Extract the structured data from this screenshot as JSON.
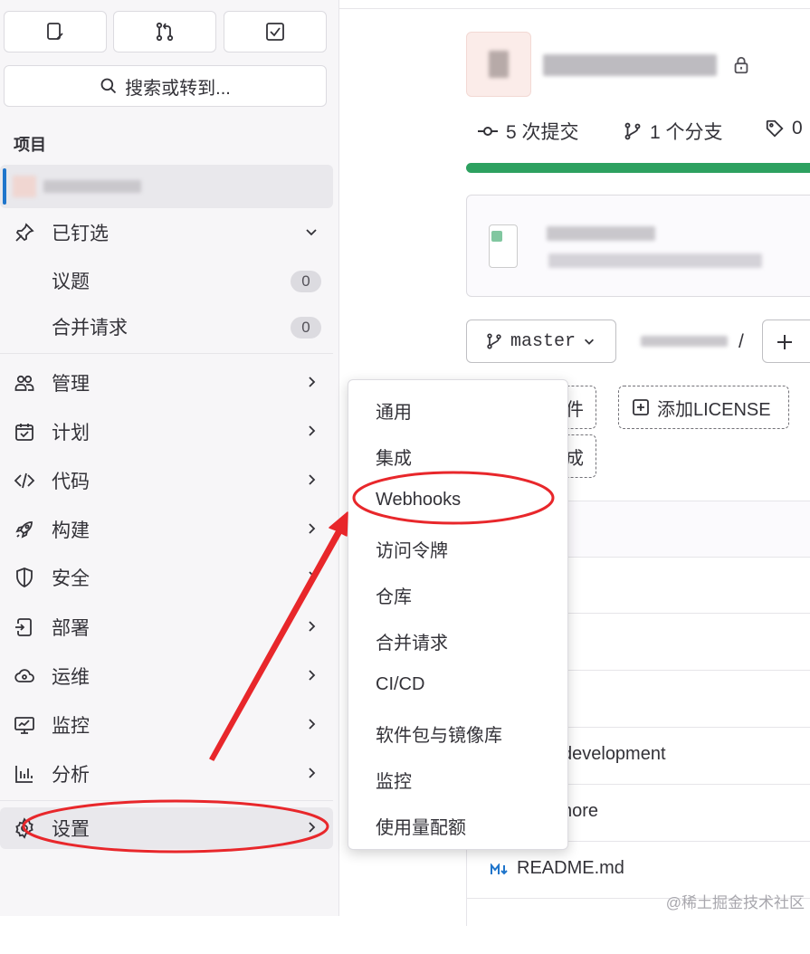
{
  "search": {
    "label": "搜索或转到..."
  },
  "sidebar": {
    "section_title": "项目",
    "pinned": {
      "label": "已钉选"
    },
    "pinned_items": [
      {
        "label": "议题",
        "count": "0"
      },
      {
        "label": "合并请求",
        "count": "0"
      }
    ],
    "items": [
      {
        "label": "管理",
        "icon": "users-icon"
      },
      {
        "label": "计划",
        "icon": "calendar-icon"
      },
      {
        "label": "代码",
        "icon": "code-icon"
      },
      {
        "label": "构建",
        "icon": "rocket-icon"
      },
      {
        "label": "安全",
        "icon": "shield-icon"
      },
      {
        "label": "部署",
        "icon": "deploy-icon"
      },
      {
        "label": "运维",
        "icon": "cloud-icon"
      },
      {
        "label": "监控",
        "icon": "monitor-icon"
      },
      {
        "label": "分析",
        "icon": "chart-icon"
      },
      {
        "label": "设置",
        "icon": "gear-icon"
      }
    ]
  },
  "project": {
    "stats": [
      {
        "label": "5 次提交",
        "icon": "commit-icon"
      },
      {
        "label": "1 个分支",
        "icon": "branch-icon"
      },
      {
        "label": "0",
        "icon": "tag-icon"
      }
    ],
    "branch": "master",
    "path_sep": "/",
    "buttons": {
      "file_partial": "件",
      "add_license": "添加LICENSE",
      "partial2": "成"
    },
    "files": [
      {
        "label": ":"
      },
      {
        "label": "development"
      },
      {
        "label": "nore"
      },
      {
        "label": "README.md"
      }
    ]
  },
  "dropdown": {
    "items": [
      "通用",
      "集成",
      "Webhooks",
      "访问令牌",
      "仓库",
      "合并请求",
      "CI/CD",
      "软件包与镜像库",
      "监控",
      "使用量配额"
    ]
  },
  "watermark": "@稀土掘金技术社区",
  "colors": {
    "accent": "#1f75cb",
    "progress": "#2da160",
    "annotation": "#e8272b"
  }
}
